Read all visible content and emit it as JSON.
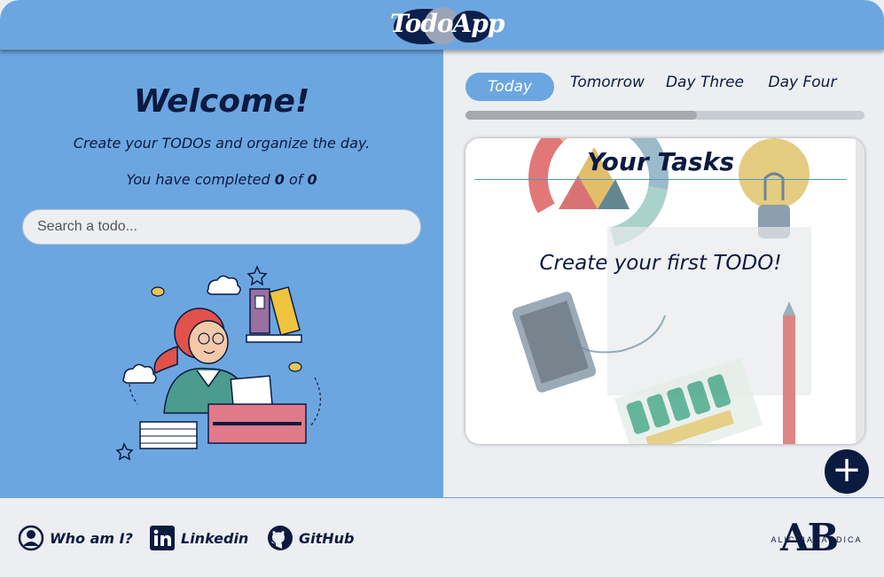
{
  "header": {
    "logo_text": "TodoApp"
  },
  "left": {
    "title": "Welcome!",
    "subtitle": "Create your TODOs and organize the day.",
    "completed_prefix": "You have completed",
    "completed_count": "0",
    "completed_of": "of",
    "total_count": "0",
    "search_placeholder": "Search a todo..."
  },
  "tabs": [
    {
      "label": "Today",
      "active": true
    },
    {
      "label": "Tomorrow",
      "active": false
    },
    {
      "label": "Day Three",
      "active": false
    },
    {
      "label": "Day Four",
      "active": false
    }
  ],
  "tab_progress_fraction": 0.58,
  "tasks": {
    "title": "Your Tasks",
    "empty_message": "Create your first TODO!"
  },
  "add_button_symbol": "+",
  "footer": {
    "links": [
      {
        "label": "Who am I?",
        "icon": "user-circle-icon"
      },
      {
        "label": "Linkedin",
        "icon": "linkedin-icon"
      },
      {
        "label": "GitHub",
        "icon": "github-icon"
      }
    ],
    "brand_initials": "AB",
    "brand_name": "ALIC BARANDICA"
  },
  "colors": {
    "primary_blue": "#6ca6e0",
    "navy": "#0b1a40",
    "background": "#eceef1"
  }
}
